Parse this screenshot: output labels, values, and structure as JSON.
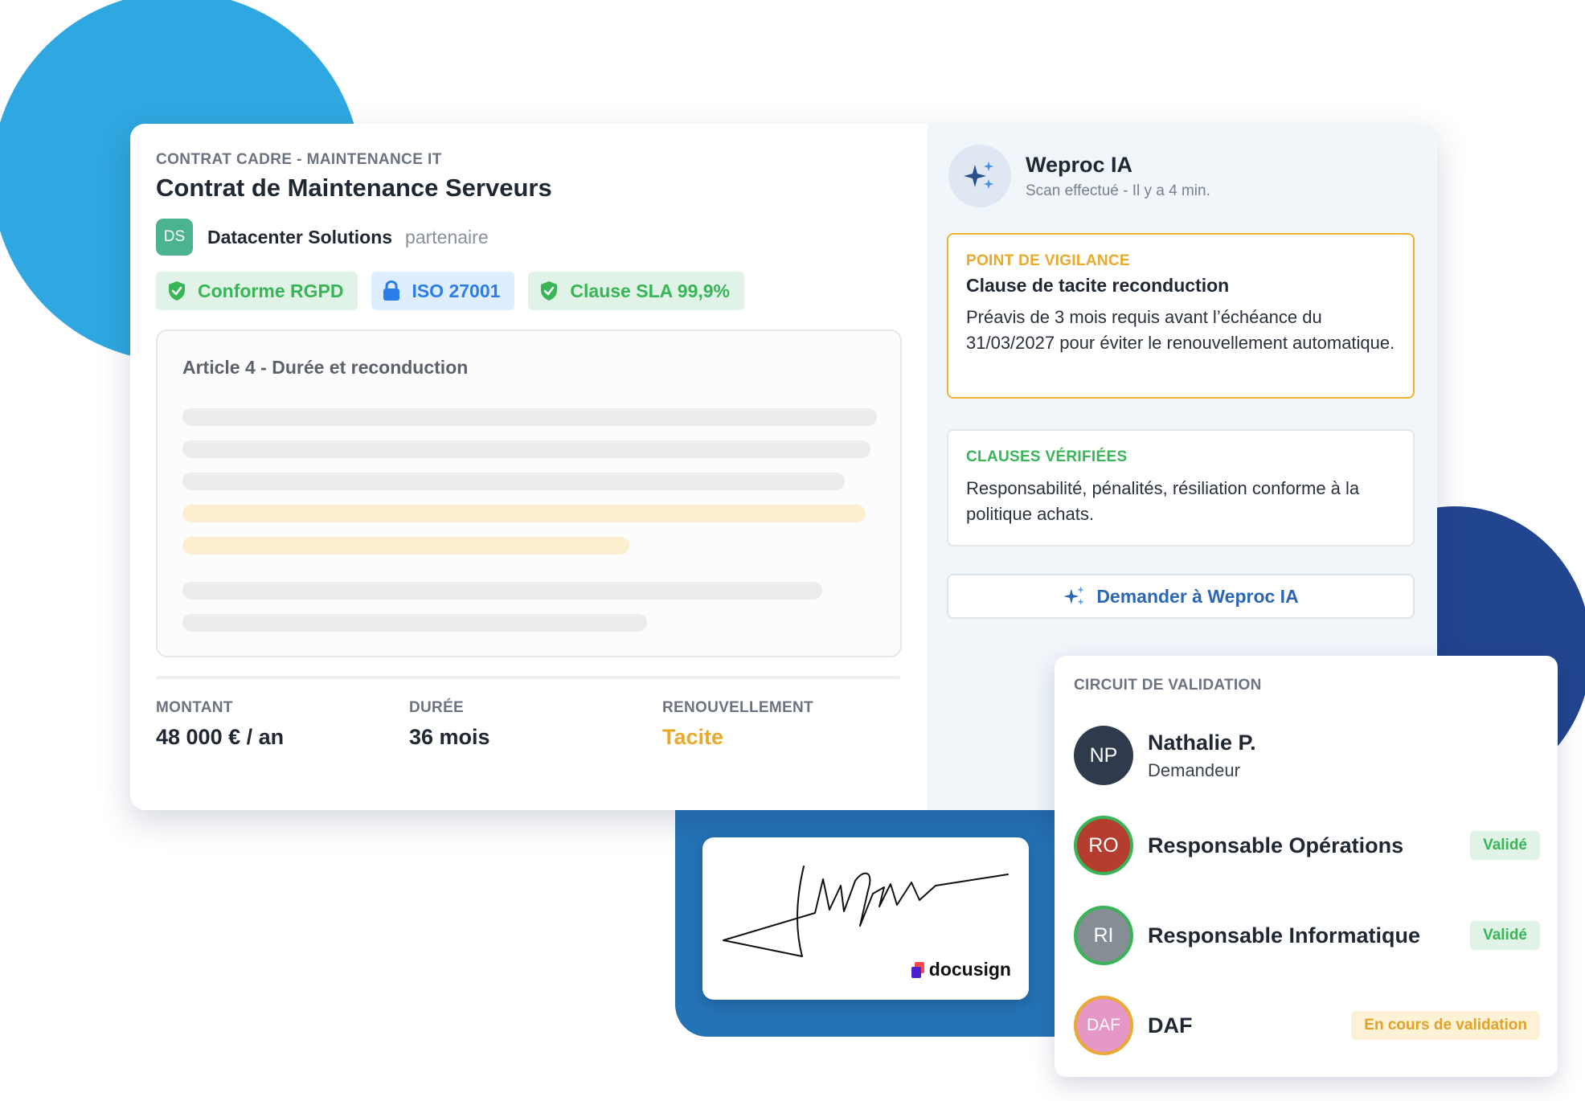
{
  "contract": {
    "eyebrow": "CONTRAT CADRE - MAINTENANCE IT",
    "title": "Contrat de Maintenance Serveurs",
    "partner": {
      "initials": "DS",
      "name": "Datacenter Solutions",
      "role": "partenaire"
    },
    "tags": [
      {
        "label": "Conforme RGPD",
        "icon": "shield-check-icon",
        "color": "#37b557"
      },
      {
        "label": "ISO 27001",
        "icon": "lock-icon",
        "color": "#2b7ee7"
      },
      {
        "label": "Clause SLA 99,9%",
        "icon": "shield-check-icon",
        "color": "#37b557"
      }
    ],
    "article_title": "Article 4 - Durée et reconduction",
    "stats": [
      {
        "label": "MONTANT",
        "value": "48 000 € / an"
      },
      {
        "label": "DURÉE",
        "value": "36 mois"
      },
      {
        "label": "RENOUVELLEMENT",
        "value": "Tacite"
      }
    ]
  },
  "ai": {
    "name": "Weproc IA",
    "status": "Scan effectué - Il y a 4 min.",
    "icon": "sparkle-icon",
    "vigilance": {
      "eyebrow": "POINT DE VIGILANCE",
      "title": "Clause de tacite reconduction",
      "body": "Préavis de 3 mois requis avant l’échéance du 31/03/2027 pour éviter le renouvellement automatique."
    },
    "verified": {
      "eyebrow": "CLAUSES VÉRIFIÉES",
      "body": "Responsabilité, pénalités, résiliation conforme à la politique achats."
    },
    "ask_label": "Demander à Weproc IA"
  },
  "signature": {
    "brand": "docusign"
  },
  "validation": {
    "title": "CIRCUIT DE VALIDATION",
    "steps": [
      {
        "initials": "NP",
        "name": "Nathalie P.",
        "role": "Demandeur",
        "status": ""
      },
      {
        "initials": "RO",
        "name": "Responsable Opérations",
        "role": "",
        "status": "Validé"
      },
      {
        "initials": "RI",
        "name": "Responsable Informatique",
        "role": "",
        "status": "Validé"
      },
      {
        "initials": "DAF",
        "name": "DAF",
        "role": "",
        "status": "En cours de validation"
      }
    ]
  },
  "colors": {
    "accent_green": "#37b557",
    "accent_blue": "#2b7ee7",
    "accent_amber": "#e9a92a",
    "brand_blue": "#2b67b3"
  }
}
